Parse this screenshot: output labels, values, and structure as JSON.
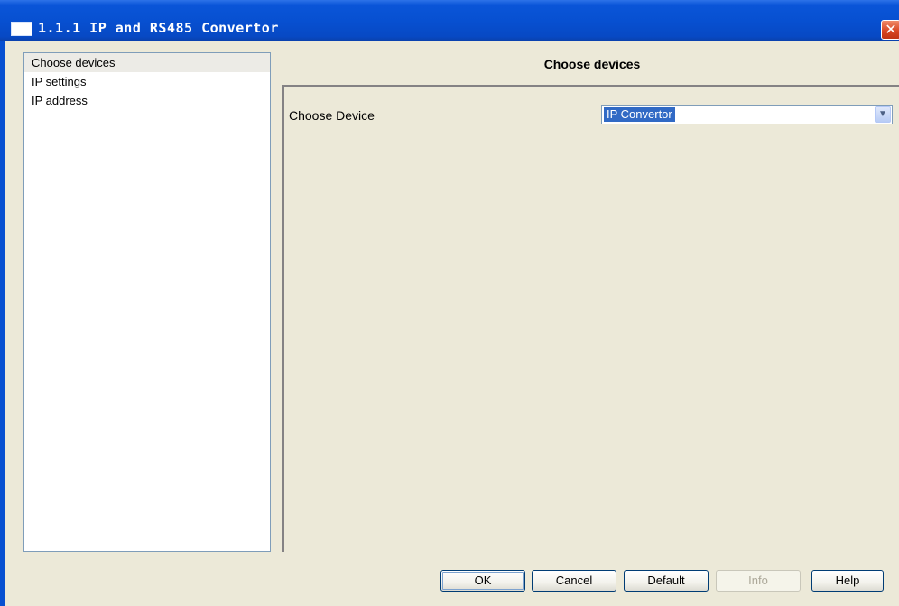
{
  "window": {
    "title": "1.1.1 IP and RS485 Convertor",
    "close_glyph": "✕"
  },
  "tree": {
    "items": [
      {
        "label": "Choose devices",
        "selected": true
      },
      {
        "label": "IP settings",
        "selected": false
      },
      {
        "label": "IP address",
        "selected": false
      }
    ]
  },
  "panel": {
    "title": "Choose devices",
    "field_label": "Choose Device",
    "select_value": "IP Convertor"
  },
  "buttons": {
    "ok": "OK",
    "cancel": "Cancel",
    "default": "Default",
    "info": "Info",
    "help": "Help"
  },
  "colors": {
    "titlebar": "#0750d1",
    "window_bg": "#ece9d8",
    "selection": "#316ac5",
    "close_button": "#d6421f"
  },
  "icons": {
    "window": "window-icon",
    "close": "close-icon",
    "dropdown": "chevron-down-icon"
  }
}
